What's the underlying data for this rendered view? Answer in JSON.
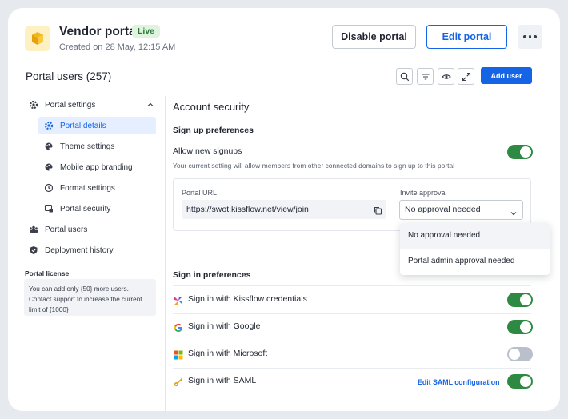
{
  "header": {
    "title": "Vendor portal",
    "status_badge": "Live",
    "created": "Created on 28 May, 12:15 AM",
    "disable_label": "Disable portal",
    "edit_label": "Edit portal"
  },
  "toolbar": {
    "portal_users_title": "Portal users (257)",
    "add_user_label": "Add user"
  },
  "sidebar": {
    "items": [
      {
        "label": "Portal settings",
        "icon": "gear-icon"
      },
      {
        "label": "Portal details",
        "icon": "gear-icon",
        "active": true
      },
      {
        "label": "Theme settings",
        "icon": "palette-icon"
      },
      {
        "label": "Mobile app branding",
        "icon": "palette-icon"
      },
      {
        "label": "Format settings",
        "icon": "clock-icon"
      },
      {
        "label": "Portal security",
        "icon": "lock-screen-icon"
      },
      {
        "label": "Portal users",
        "icon": "users-icon"
      },
      {
        "label": "Deployment history",
        "icon": "shield-icon"
      }
    ],
    "license_title": "Portal license",
    "license_text": "You can add only {50} more users. Contact support to increase the current limit of {1000}"
  },
  "main": {
    "title": "Account security",
    "signup_heading": "Sign up preferences",
    "allow_signups_label": "Allow new signups",
    "allow_signups_desc": "Your current setting will allow members from other connected domains to sign up to this portal",
    "allow_signups_on": true,
    "portal_url_label": "Portal URL",
    "portal_url_value": "https://swot.kissflow.net/view/join",
    "invite_label": "Invite approval",
    "invite_value": "No approval needed",
    "invite_options": [
      "No approval needed",
      "Portal admin approval needed"
    ],
    "signin_heading": "Sign in preferences",
    "signin_options": [
      {
        "label": "Sign in with Kissflow credentials",
        "icon": "kissflow-icon",
        "enabled": true
      },
      {
        "label": "Sign in with Google",
        "icon": "google-icon",
        "enabled": true
      },
      {
        "label": "Sign in with Microsoft",
        "icon": "microsoft-icon",
        "enabled": false
      },
      {
        "label": "Sign in with SAML",
        "icon": "key-icon",
        "enabled": true
      }
    ],
    "saml_link": "Edit SAML configuration"
  },
  "colors": {
    "accent": "#1664e6",
    "toggle_on": "#2e8a43",
    "toggle_off": "#b9bfcb",
    "live_badge_bg": "#dff3df"
  }
}
